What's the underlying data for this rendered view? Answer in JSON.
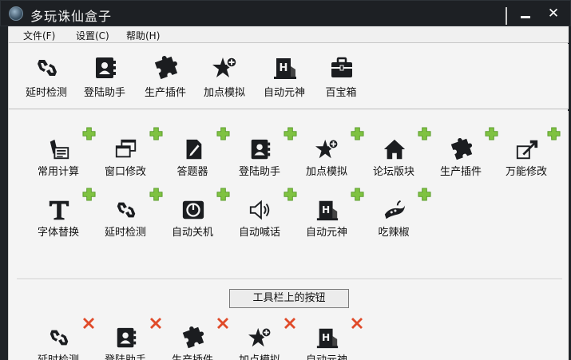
{
  "window": {
    "title": "多玩诛仙盒子"
  },
  "menu": [
    "文件(F)",
    "设置(C)",
    "帮助(H)"
  ],
  "toolbar": [
    {
      "label": "延时检测",
      "icon": "chain-link-icon"
    },
    {
      "label": "登陆助手",
      "icon": "contact-book-icon"
    },
    {
      "label": "生产插件",
      "icon": "puzzle-piece-icon"
    },
    {
      "label": "加点模拟",
      "icon": "star-plus-icon"
    },
    {
      "label": "自动元神",
      "icon": "hotel-icon"
    },
    {
      "label": "百宝箱",
      "icon": "toolbox-icon"
    }
  ],
  "available_tools": [
    {
      "label": "常用计算",
      "icon": "calculator-note-icon"
    },
    {
      "label": "窗口修改",
      "icon": "windows-stack-icon"
    },
    {
      "label": "答题器",
      "icon": "pencil-doc-icon"
    },
    {
      "label": "登陆助手",
      "icon": "contact-book-icon"
    },
    {
      "label": "加点模拟",
      "icon": "star-plus-icon"
    },
    {
      "label": "论坛版块",
      "icon": "home-icon"
    },
    {
      "label": "生产插件",
      "icon": "puzzle-piece-icon"
    },
    {
      "label": "万能修改",
      "icon": "resize-arrow-icon"
    },
    {
      "label": "字体替换",
      "icon": "font-t-icon"
    },
    {
      "label": "延时检测",
      "icon": "chain-link-icon"
    },
    {
      "label": "自动关机",
      "icon": "power-clock-icon"
    },
    {
      "label": "自动喊话",
      "icon": "speaker-icon"
    },
    {
      "label": "自动元神",
      "icon": "hotel-icon"
    },
    {
      "label": "吃辣椒",
      "icon": "chili-pepper-icon"
    }
  ],
  "toolbar_section": {
    "caption": "工具栏上的按钮",
    "items": [
      {
        "label": "延时检测",
        "icon": "chain-link-icon"
      },
      {
        "label": "登陆助手",
        "icon": "contact-book-icon"
      },
      {
        "label": "生产插件",
        "icon": "puzzle-piece-icon"
      },
      {
        "label": "加点模拟",
        "icon": "star-plus-icon"
      },
      {
        "label": "自动元神",
        "icon": "hotel-icon"
      }
    ]
  },
  "colors": {
    "add": "#7fc241",
    "remove": "#e04b2a",
    "icon": "#1b1d20",
    "titlebar": "#1d2024"
  }
}
